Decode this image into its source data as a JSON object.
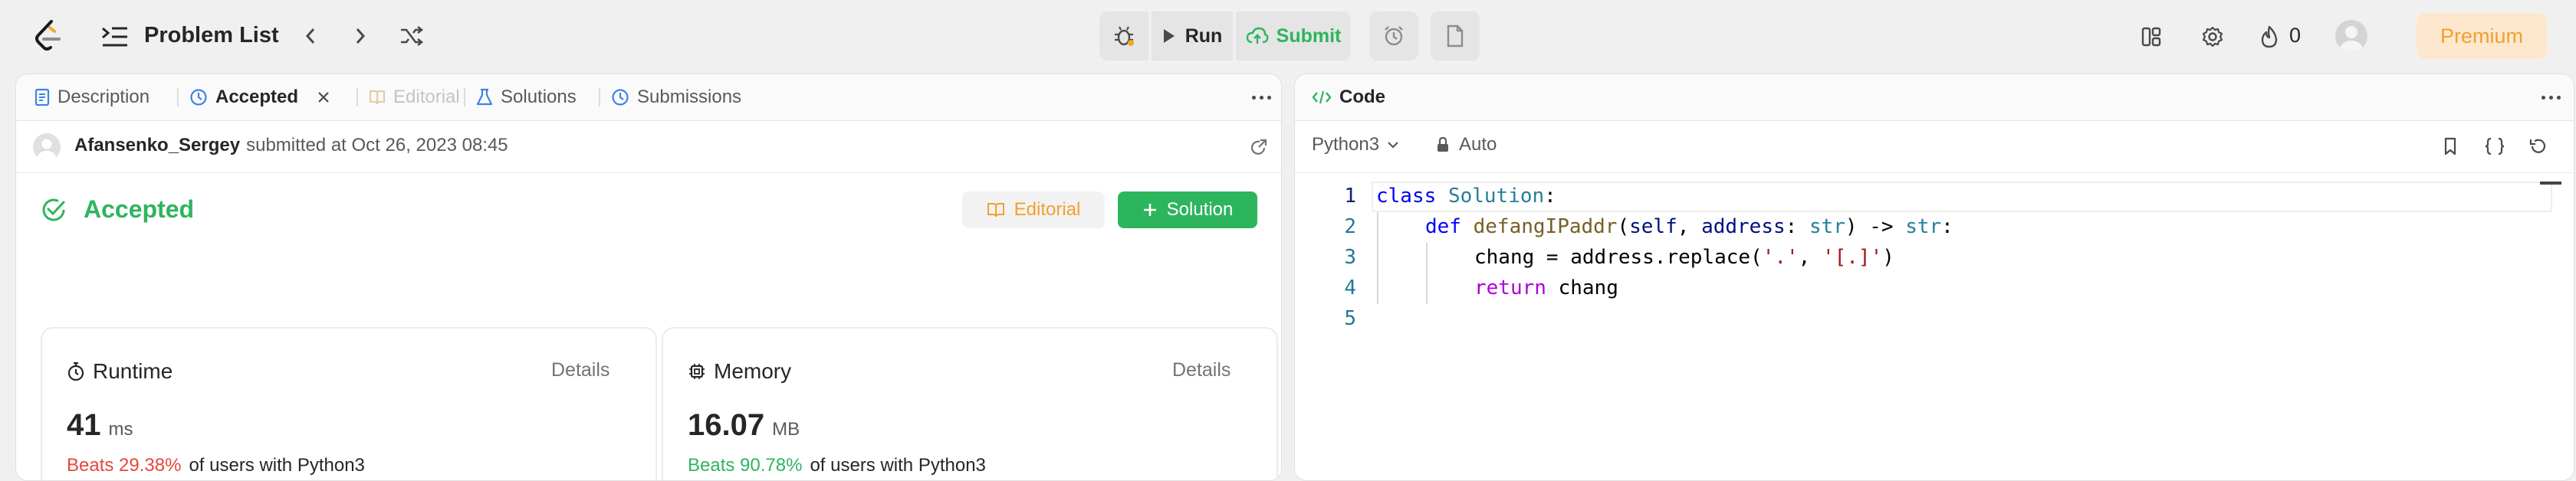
{
  "topbar": {
    "problem_list": "Problem List",
    "run": "Run",
    "submit": "Submit",
    "streak": "0",
    "premium": "Premium"
  },
  "left_panel": {
    "tabs": [
      "Description",
      "Accepted",
      "Editorial",
      "Solutions",
      "Submissions"
    ],
    "submitter": "Afansenko_Sergey",
    "submitted_text": "submitted at Oct 26, 2023 08:45",
    "status": "Accepted",
    "editorial_btn": "Editorial",
    "solution_btn": "Solution",
    "runtime": {
      "title": "Runtime",
      "details": "Details",
      "value": "41",
      "unit": "ms",
      "beats": "Beats 29.38%",
      "suffix": "of users with Python3"
    },
    "memory": {
      "title": "Memory",
      "details": "Details",
      "value": "16.07",
      "unit": "MB",
      "beats": "Beats 90.78%",
      "suffix": "of users with Python3"
    }
  },
  "code_panel": {
    "title": "Code",
    "language": "Python3",
    "auto": "Auto",
    "line_numbers": [
      "1",
      "2",
      "3",
      "4",
      "5"
    ],
    "code": {
      "l1_kw": "class",
      "l1_cls": "Solution",
      "l1_end": ":",
      "l2_kw": "def",
      "l2_fn": "defangIPaddr",
      "l2_p1": "(",
      "l2_self": "self",
      "l2_p2": ", ",
      "l2_addr": "address",
      "l2_p3": ": ",
      "l2_t1": "str",
      "l2_p4": ") -> ",
      "l2_t2": "str",
      "l2_p5": ":",
      "l3_a": "chang = address.replace(",
      "l3_s1": "'.'",
      "l3_b": ", ",
      "l3_s2": "'[.]'",
      "l3_c": ")",
      "l4_kw": "return",
      "l4_rest": " chang"
    }
  },
  "colors": {
    "accent_green": "#2db55d",
    "accent_orange": "#f2a02d",
    "beats_red": "#e8463a",
    "editor_keyword": "#0000ff"
  }
}
